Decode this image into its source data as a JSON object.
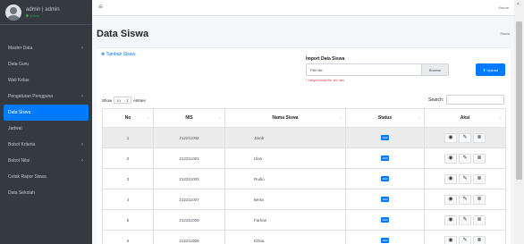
{
  "user": {
    "name": "admin | admin",
    "status": "online"
  },
  "sidebar": {
    "items": [
      {
        "label": "Master Data",
        "chevron": "‹"
      },
      {
        "label": "Data Guru",
        "chevron": ""
      },
      {
        "label": "Wali Kelas",
        "chevron": ""
      },
      {
        "label": "Pengaturan Pengguna",
        "chevron": "‹"
      },
      {
        "label": "Data Siswa",
        "chevron": ""
      },
      {
        "label": "Jadwal",
        "chevron": ""
      },
      {
        "label": "Bobot Kriteria",
        "chevron": "‹"
      },
      {
        "label": "Bobot Nilai",
        "chevron": "‹"
      },
      {
        "label": "Cetak Rapor Siswa",
        "chevron": ""
      },
      {
        "label": "Data Sekolah",
        "chevron": ""
      }
    ],
    "active_index": 4
  },
  "topbar": {
    "menu_icon": "≡",
    "logout": "Keluar"
  },
  "page": {
    "title": "Data Siswa",
    "breadcrumb": "Siswa"
  },
  "card": {
    "add_label": "Tambah Siswa",
    "import_title": "Import Data Siswa",
    "file_placeholder": "Pilih file",
    "browse_label": "Browse",
    "upload_label": "Upload",
    "file_hint": "* Hanya format file .xls/.xlsx"
  },
  "table_controls": {
    "show_label": "Show",
    "length_value": "10",
    "entries_label": "entries",
    "search_label": "Search:"
  },
  "table": {
    "columns": [
      "No",
      "NIS",
      "Nama Siswa",
      "Status",
      "Aksi"
    ],
    "rows": [
      {
        "no": "1",
        "nis": "212211002",
        "nama": "Jarob",
        "status": "Aktif"
      },
      {
        "no": "2",
        "nis": "212211001",
        "nama": "Ulan",
        "status": "Aktif"
      },
      {
        "no": "3",
        "nis": "212211003",
        "nama": "Rudio",
        "status": "Aktif"
      },
      {
        "no": "4",
        "nis": "212211007",
        "nama": "Berta",
        "status": "Aktif"
      },
      {
        "no": "5",
        "nis": "212211005",
        "nama": "Farhan",
        "status": "Aktif"
      },
      {
        "no": "6",
        "nis": "212211006",
        "nama": "Erlina",
        "status": "Aktif"
      }
    ],
    "highlight_row": 0
  },
  "colors": {
    "primary": "#007bff",
    "sidebar": "#343a40",
    "online": "#28a745",
    "danger": "#dc3545"
  }
}
